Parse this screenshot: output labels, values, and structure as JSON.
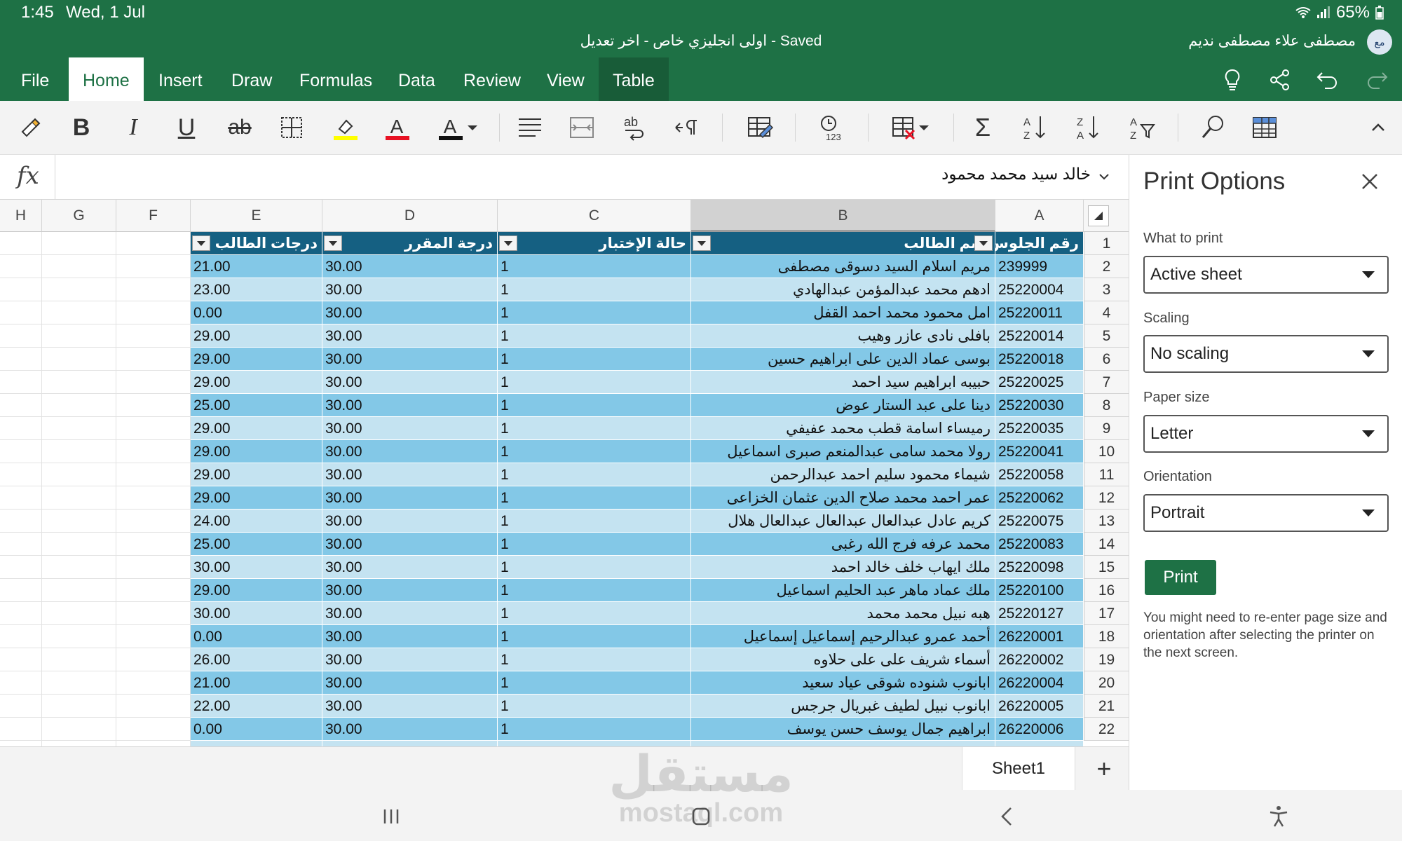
{
  "status": {
    "time": "1:45",
    "date": "Wed, 1 Jul",
    "battery": "65%"
  },
  "title": {
    "document": "اولى انجليزي  خاص - اخر تعديل - Saved",
    "user": "مصطفى علاء مصطفى نديم",
    "avatar_initials": "مع"
  },
  "menu": {
    "tabs": [
      "File",
      "Home",
      "Insert",
      "Draw",
      "Formulas",
      "Data",
      "Review",
      "View",
      "Table"
    ],
    "active": "Home"
  },
  "ribbon": {
    "icons": [
      "format-painter-icon",
      "bold-icon",
      "italic-icon",
      "underline-icon",
      "strikethrough-icon",
      "borders-icon",
      "fill-color-icon",
      "font-color-icon",
      "font-color-dropdown-icon",
      "align-icon",
      "merge-icon",
      "wrap-text-icon",
      "text-direction-icon",
      "format-as-table-icon",
      "number-format-icon",
      "delete-cells-icon",
      "autosum-icon",
      "sort-ascending-icon",
      "sort-descending-icon",
      "filter-icon",
      "find-icon",
      "table-style-icon",
      "collapse-ribbon-icon"
    ],
    "fill_color": "#ffff00",
    "font_color": "#e81123",
    "text_color": "#111111"
  },
  "formula_bar": {
    "fx": "fx",
    "value": "خالد سيد محمد محمود"
  },
  "grid": {
    "columns": [
      "H",
      "G",
      "F",
      "E",
      "D",
      "C",
      "B",
      "A"
    ],
    "selected_column": "B",
    "headers": {
      "A": "رقم الجلوس",
      "B": "اسم الطالب",
      "C": "حالة الإختبار",
      "D": "درجة المقرر",
      "E": "درجات الطالب"
    },
    "rows": [
      {
        "n": "2",
        "A": "239999",
        "B": "مريم اسلام السيد دسوقى مصطفى",
        "C": "1",
        "D": "30.00",
        "E": "21.00"
      },
      {
        "n": "3",
        "A": "25220004",
        "B": "ادهم محمد عبدالمؤمن عبدالهادي",
        "C": "1",
        "D": "30.00",
        "E": "23.00"
      },
      {
        "n": "4",
        "A": "25220011",
        "B": "امل محمود محمد احمد القفل",
        "C": "1",
        "D": "30.00",
        "E": "0.00"
      },
      {
        "n": "5",
        "A": "25220014",
        "B": "بافلى نادى عازر وهيب",
        "C": "1",
        "D": "30.00",
        "E": "29.00"
      },
      {
        "n": "6",
        "A": "25220018",
        "B": "بوسى عماد الدين على ابراهيم حسين",
        "C": "1",
        "D": "30.00",
        "E": "29.00"
      },
      {
        "n": "7",
        "A": "25220025",
        "B": "حبيبه ابراهيم سيد احمد",
        "C": "1",
        "D": "30.00",
        "E": "29.00"
      },
      {
        "n": "8",
        "A": "25220030",
        "B": "دينا على عبد الستار عوض",
        "C": "1",
        "D": "30.00",
        "E": "25.00"
      },
      {
        "n": "9",
        "A": "25220035",
        "B": "رميساء اسامة قطب محمد عفيفي",
        "C": "1",
        "D": "30.00",
        "E": "29.00"
      },
      {
        "n": "10",
        "A": "25220041",
        "B": "رولا محمد سامى عبدالمنعم صبرى اسماعيل",
        "C": "1",
        "D": "30.00",
        "E": "29.00"
      },
      {
        "n": "11",
        "A": "25220058",
        "B": "شيماء محمود سليم احمد عبدالرحمن",
        "C": "1",
        "D": "30.00",
        "E": "29.00"
      },
      {
        "n": "12",
        "A": "25220062",
        "B": "عمر احمد محمد صلاح الدين عثمان الخزاعى",
        "C": "1",
        "D": "30.00",
        "E": "29.00"
      },
      {
        "n": "13",
        "A": "25220075",
        "B": "كريم عادل عبدالعال عبدالعال عبدالعال هلال",
        "C": "1",
        "D": "30.00",
        "E": "24.00"
      },
      {
        "n": "14",
        "A": "25220083",
        "B": "محمد عرفه فرج الله رغبى",
        "C": "1",
        "D": "30.00",
        "E": "25.00"
      },
      {
        "n": "15",
        "A": "25220098",
        "B": "ملك ايهاب خلف خالد احمد",
        "C": "1",
        "D": "30.00",
        "E": "30.00"
      },
      {
        "n": "16",
        "A": "25220100",
        "B": "ملك عماد ماهر عبد الحليم اسماعيل",
        "C": "1",
        "D": "30.00",
        "E": "29.00"
      },
      {
        "n": "17",
        "A": "25220127",
        "B": "هبه نبيل محمد محمد",
        "C": "1",
        "D": "30.00",
        "E": "30.00"
      },
      {
        "n": "18",
        "A": "26220001",
        "B": "أحمد عمرو عبدالرحيم إسماعيل إسماعيل",
        "C": "1",
        "D": "30.00",
        "E": "0.00"
      },
      {
        "n": "19",
        "A": "26220002",
        "B": "أسماء شريف على على حلاوه",
        "C": "1",
        "D": "30.00",
        "E": "26.00"
      },
      {
        "n": "20",
        "A": "26220004",
        "B": "ابانوب شنوده شوقى عياد سعيد",
        "C": "1",
        "D": "30.00",
        "E": "21.00"
      },
      {
        "n": "21",
        "A": "26220005",
        "B": "ابانوب نبيل لطيف غبريال جرجس",
        "C": "1",
        "D": "30.00",
        "E": "22.00"
      },
      {
        "n": "22",
        "A": "26220006",
        "B": "ابراهيم جمال يوسف حسن يوسف",
        "C": "1",
        "D": "30.00",
        "E": "0.00"
      }
    ],
    "band_colors": {
      "header": "#156082",
      "odd": "#83c8e7",
      "even": "#c4e3f1"
    }
  },
  "sheets": {
    "active": "Sheet1",
    "add": "+"
  },
  "print_panel": {
    "title": "Print Options",
    "what_to_print_label": "What to print",
    "what_to_print": "Active sheet",
    "scaling_label": "Scaling",
    "scaling": "No scaling",
    "paper_size_label": "Paper size",
    "paper_size": "Letter",
    "orientation_label": "Orientation",
    "orientation": "Portrait",
    "print_button": "Print",
    "note": "You might need to re-enter page size and orientation after selecting the printer on the next screen."
  },
  "watermark": {
    "arabic": "مستقل",
    "latin": "mostaql.com"
  },
  "accent_color": "#1e7145"
}
